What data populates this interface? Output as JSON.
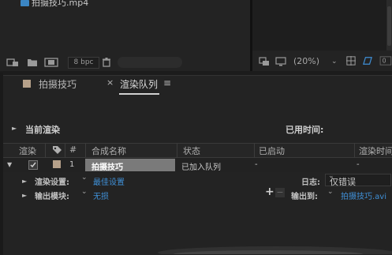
{
  "project": {
    "file_name": "拍摄技巧.mp4",
    "bpc_label": "8 bpc"
  },
  "viewer": {
    "zoom": "(20%)"
  },
  "tabs": [
    {
      "label": "拍摄技巧",
      "swatch_color": "#b6a18a"
    },
    {
      "label": "渲染队列",
      "close": "×",
      "menu": "≡"
    }
  ],
  "current_render": {
    "label": "当前渲染",
    "elapsed_label": "已用时间:"
  },
  "columns": [
    "渲染",
    "#",
    "合成名称",
    "状态",
    "已启动",
    "渲染时间"
  ],
  "item": {
    "number": "1",
    "comp_name": "拍摄技巧",
    "status": "已加入队列",
    "started": "-",
    "render_time": "-"
  },
  "render_settings": {
    "label": "渲染设置:",
    "value": "最佳设置"
  },
  "output_module": {
    "label": "输出模块:",
    "value": "无损"
  },
  "log": {
    "label": "日志:",
    "value": "仅错误"
  },
  "output_to": {
    "label": "输出到:",
    "value": "拍摄技巧.avi"
  },
  "add_remove": {
    "add": "+",
    "remove": "−"
  }
}
